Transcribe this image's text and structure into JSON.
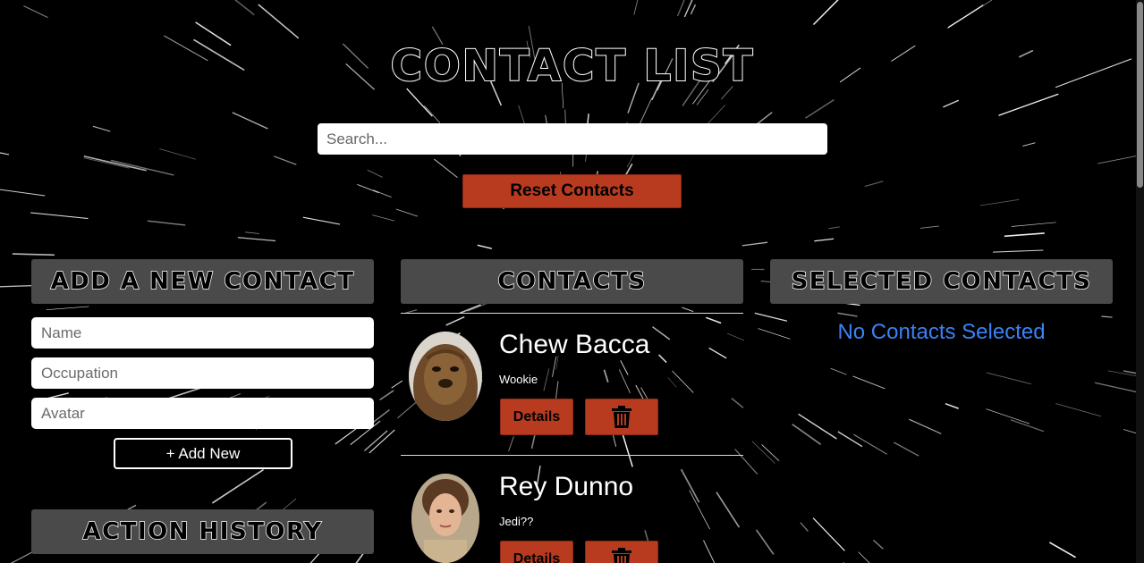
{
  "header": {
    "title": "Contact List"
  },
  "search": {
    "placeholder": "Search..."
  },
  "reset_label": "Reset Contacts",
  "add_section": {
    "title": "Add a New Contact",
    "name_placeholder": "Name",
    "occupation_placeholder": "Occupation",
    "avatar_placeholder": "Avatar",
    "add_label": "+ Add New"
  },
  "contacts_section": {
    "title": "Contacts",
    "items": [
      {
        "name": "Chew Bacca",
        "occupation": "Wookie",
        "details_label": "Details",
        "delete_icon": "trash-icon"
      },
      {
        "name": "Rey Dunno",
        "occupation": "Jedi??",
        "details_label": "Details",
        "delete_icon": "trash-icon"
      }
    ]
  },
  "selected_section": {
    "title": "Selected Contacts",
    "empty_message": "No Contacts Selected"
  },
  "history_section": {
    "title": "Action History"
  },
  "colors": {
    "background": "#000000",
    "button_rust": "#b83b20",
    "header_gray": "#4a4a4a",
    "link_blue": "#3b82f6"
  }
}
